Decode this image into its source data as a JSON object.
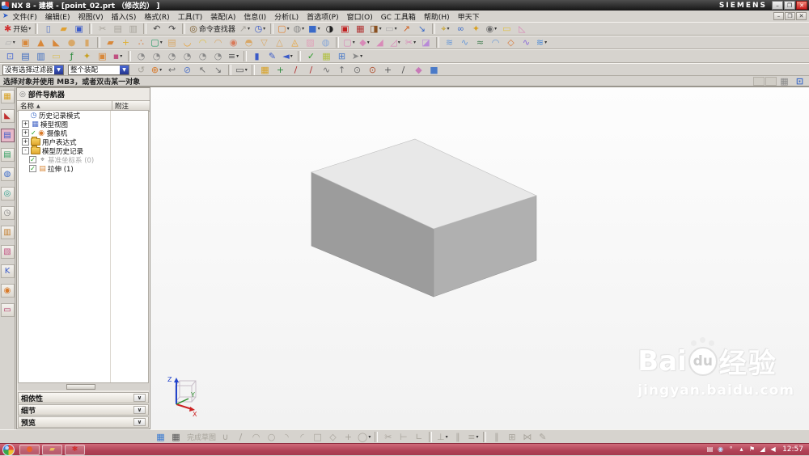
{
  "window": {
    "title": "NX 8 - 建模 - [point_02.prt （修改的） ]",
    "brand": "SIEMENS",
    "min_glyph": "–",
    "restore_glyph": "❐",
    "close_glyph": "✕"
  },
  "menubar": {
    "items": [
      "文件(F)",
      "编辑(E)",
      "视图(V)",
      "插入(S)",
      "格式(R)",
      "工具(T)",
      "装配(A)",
      "信息(I)",
      "分析(L)",
      "首选项(P)",
      "窗口(O)",
      "GC 工具箱",
      "帮助(H)",
      "甲天下"
    ]
  },
  "toolbars": {
    "row1": [
      {
        "name": "start-button",
        "g": "✱",
        "c": "#d03030",
        "label": "开始",
        "dd": true
      },
      {
        "sep": true
      },
      {
        "name": "new-button",
        "g": "▯",
        "c": "#5a7ac8"
      },
      {
        "name": "open-button",
        "g": "▰",
        "c": "#e0a030"
      },
      {
        "name": "save-button",
        "g": "▣",
        "c": "#3a5ac8"
      },
      {
        "sep": true
      },
      {
        "name": "cut-button",
        "g": "✂",
        "c": "#9a968e",
        "gray": true
      },
      {
        "name": "copy-button",
        "g": "▤",
        "c": "#9a968e",
        "gray": true
      },
      {
        "name": "paste-button",
        "g": "▥",
        "c": "#9a968e",
        "gray": true
      },
      {
        "sep": true
      },
      {
        "name": "undo-button",
        "g": "↶",
        "c": "#444444"
      },
      {
        "name": "redo-button",
        "g": "↷",
        "c": "#444444"
      },
      {
        "sep": true
      },
      {
        "name": "command-finder-button",
        "g": "◎",
        "c": "#7a5a2a",
        "label": "命令查找器"
      },
      {
        "name": "touch-mode-button",
        "g": "↗",
        "c": "#9a968e",
        "gray": true,
        "dd": true
      },
      {
        "name": "history-palette-button",
        "g": "◷",
        "c": "#3a5ac8",
        "dd": true
      },
      {
        "sep": true
      },
      {
        "name": "screenshot-button",
        "g": "▢",
        "c": "#e08030",
        "dd": true
      },
      {
        "name": "rotate-view-button",
        "g": "◍",
        "c": "#8a8a8a",
        "dd": true
      },
      {
        "name": "view-cube-button",
        "g": "■",
        "c": "#3a6ac8",
        "dd": true
      },
      {
        "name": "clock-display-button",
        "g": "◑",
        "c": "#222222"
      },
      {
        "name": "material-box-button",
        "g": "▣",
        "c": "#c02020"
      },
      {
        "name": "assembly-box-button",
        "g": "▦",
        "c": "#b03030"
      },
      {
        "name": "module-box-button",
        "g": "◨",
        "c": "#8a5020",
        "dd": true
      },
      {
        "name": "blank-window-button",
        "g": "▭",
        "c": "#aaaaaa",
        "dd": true
      },
      {
        "name": "move-object-button",
        "g": "↗",
        "c": "#d06020"
      },
      {
        "name": "copy-object-button",
        "g": "↘",
        "c": "#3a6ac8"
      },
      {
        "sep": true
      },
      {
        "name": "wcs-button",
        "g": "⌖",
        "c": "#c8a020",
        "dd": true
      },
      {
        "name": "link-button",
        "g": "∞",
        "c": "#3a6ac8"
      },
      {
        "name": "key-button",
        "g": "✦",
        "c": "#d8a020"
      },
      {
        "name": "show-hide-button",
        "g": "◉",
        "c": "#707070",
        "dd": true
      },
      {
        "name": "measure-button",
        "g": "▭",
        "c": "#e0c040"
      },
      {
        "name": "angle-measure-button",
        "g": "◺",
        "c": "#d88ab8"
      }
    ],
    "row2": [
      {
        "name": "datum-plane-button",
        "g": "▱",
        "c": "#b0b0b0",
        "dd": true
      },
      {
        "name": "block-button",
        "g": "▣",
        "c": "#d8883a"
      },
      {
        "name": "cone-button",
        "g": "▲",
        "c": "#d8883a"
      },
      {
        "name": "wedge-button",
        "g": "◣",
        "c": "#d8883a"
      },
      {
        "name": "sphere-button",
        "g": "●",
        "c": "#d8a868"
      },
      {
        "name": "cylinder-button",
        "g": "▮",
        "c": "#d8a868"
      },
      {
        "sep": true
      },
      {
        "name": "sheet-button",
        "g": "▰",
        "c": "#d8883a"
      },
      {
        "name": "datum-axis-button",
        "g": "+",
        "c": "#e0b030"
      },
      {
        "name": "point-set-button",
        "g": "∴",
        "c": "#d87a3a"
      },
      {
        "name": "sketch-button",
        "g": "▢",
        "c": "#2a9a6a",
        "dd": true
      },
      {
        "name": "extrude-button",
        "g": "▤",
        "c": "#d8a868"
      },
      {
        "name": "revolve-button",
        "g": "◡",
        "c": "#e8a030"
      },
      {
        "name": "sweep-button",
        "g": "◠",
        "c": "#e0c040"
      },
      {
        "name": "tube-button",
        "g": "◠",
        "c": "#d8a868"
      },
      {
        "name": "hole-button",
        "g": "◉",
        "c": "#d87a5a"
      },
      {
        "name": "boss-button",
        "g": "◓",
        "c": "#d8a868"
      },
      {
        "name": "pocket-button",
        "g": "▽",
        "c": "#d8a868"
      },
      {
        "name": "pad-button",
        "g": "△",
        "c": "#d8a868"
      },
      {
        "name": "emboss-button",
        "g": "◬",
        "c": "#e8a030"
      },
      {
        "name": "sheet-body-button",
        "g": "▨",
        "c": "#e0a0b8"
      },
      {
        "name": "sphere-surface-button",
        "g": "◍",
        "c": "#88a8d8"
      },
      {
        "sep": true
      },
      {
        "name": "shell-button",
        "g": "▢",
        "c": "#d88ab8",
        "dd": true
      },
      {
        "name": "edge-blend-button",
        "g": "◆",
        "c": "#d88ab8",
        "dd": true
      },
      {
        "name": "chamfer-button",
        "g": "◢",
        "c": "#d88ab8"
      },
      {
        "name": "draft-button",
        "g": "◿",
        "c": "#d88ab8",
        "dd": true
      },
      {
        "name": "trim-body-button",
        "g": "✂",
        "c": "#d88ab8",
        "dd": true
      },
      {
        "name": "patch-button",
        "g": "◪",
        "c": "#b88ad8"
      },
      {
        "sep": true
      },
      {
        "name": "four-point-surface-button",
        "g": "≋",
        "c": "#6a9ad8"
      },
      {
        "name": "swept-button",
        "g": "∿",
        "c": "#6a9ad8"
      },
      {
        "name": "through-curves-button",
        "g": "≈",
        "c": "#3a7a4a"
      },
      {
        "name": "styled-sweep-button",
        "g": "◠",
        "c": "#6a9ad8"
      },
      {
        "name": "n-sided-surface-button",
        "g": "◇",
        "c": "#d87a3a"
      },
      {
        "name": "studio-surface-button",
        "g": "∿",
        "c": "#8a6ad8"
      },
      {
        "name": "more-surface-button",
        "g": "≋",
        "c": "#4a8ad8",
        "dd": true
      }
    ],
    "row3": [
      {
        "name": "fit-view-button",
        "g": "⊡",
        "c": "#4a6ad0"
      },
      {
        "name": "layer-settings-button",
        "g": "▤",
        "c": "#3a6ac0"
      },
      {
        "name": "layer-visible-button",
        "g": "▥",
        "c": "#3a6ac0"
      },
      {
        "name": "annotation-button",
        "g": "▭",
        "c": "#d8c060"
      },
      {
        "name": "expression-button",
        "g": "ƒ",
        "c": "#2a8a3a"
      },
      {
        "name": "tools-button",
        "g": "✦",
        "c": "#c8a020"
      },
      {
        "name": "part-module-button",
        "g": "▣",
        "c": "#d8883a"
      },
      {
        "name": "customize-button",
        "g": "▪",
        "c": "#c05080",
        "dd": true
      },
      {
        "sep": true
      },
      {
        "name": "render-style-1-button",
        "g": "◔",
        "c": "#888888"
      },
      {
        "name": "render-style-2-button",
        "g": "◔",
        "c": "#888888"
      },
      {
        "name": "render-style-3-button",
        "g": "◔",
        "c": "#888888"
      },
      {
        "name": "render-style-4-button",
        "g": "◔",
        "c": "#888888"
      },
      {
        "name": "render-style-5-button",
        "g": "◔",
        "c": "#888888"
      },
      {
        "name": "render-style-6-button",
        "g": "◔",
        "c": "#888888"
      },
      {
        "name": "render-list-button",
        "g": "≡",
        "c": "#555555",
        "dd": true
      },
      {
        "sep": true
      },
      {
        "name": "material-edit-button",
        "g": "▮",
        "c": "#3a5ac8"
      },
      {
        "name": "pen-button",
        "g": "✎",
        "c": "#3a5ac8"
      },
      {
        "name": "erase-button",
        "g": "◄",
        "c": "#3a5ac8",
        "dd": true
      },
      {
        "sep": true
      },
      {
        "name": "check-mate-button",
        "g": "✓",
        "c": "#2a9a2a"
      },
      {
        "name": "sheet-check-button",
        "g": "▦",
        "c": "#b0c040"
      },
      {
        "name": "grid-button",
        "g": "⊞",
        "c": "#4a7ac8"
      },
      {
        "name": "select-tool-button",
        "g": "➤",
        "c": "#888888",
        "dd": true
      }
    ],
    "selection": [
      {
        "name": "refresh-button",
        "g": "↺",
        "c": "#9a968e",
        "gray": true
      },
      {
        "name": "add-to-selection-button",
        "g": "⊕",
        "c": "#d87a2a",
        "dd": true
      },
      {
        "name": "previous-selection-button",
        "g": "↩",
        "c": "#707070"
      },
      {
        "name": "deselect-all-button",
        "g": "⊘",
        "c": "#5a7ac8"
      },
      {
        "name": "select-handle-button",
        "g": "↖",
        "c": "#707070"
      },
      {
        "name": "select-handle2-button",
        "g": "↘",
        "c": "#707070"
      },
      {
        "sep": true
      },
      {
        "name": "rectangle-select-button",
        "g": "▭",
        "c": "#555555",
        "dd": true
      },
      {
        "sep": true
      },
      {
        "name": "snap-point-toggle-button",
        "g": "▦",
        "c": "#d8a020"
      },
      {
        "name": "snap-point-settings-button",
        "g": "+",
        "c": "#2a8a3a"
      },
      {
        "name": "end-point-button",
        "g": "/",
        "c": "#b03030"
      },
      {
        "name": "mid-point-button",
        "g": "/",
        "c": "#b03030"
      },
      {
        "name": "control-point-button",
        "g": "∿",
        "c": "#707070"
      },
      {
        "name": "intersection-button",
        "g": "↑",
        "c": "#707070"
      },
      {
        "name": "arc-center-button",
        "g": "⊙",
        "c": "#707070"
      },
      {
        "name": "quadrant-point-button",
        "g": "⊙",
        "c": "#b05030"
      },
      {
        "name": "existing-point-button",
        "g": "+",
        "c": "#555555"
      },
      {
        "name": "point-on-curve-button",
        "g": "/",
        "c": "#555555"
      },
      {
        "name": "point-on-surface-button",
        "g": "◆",
        "c": "#c87ab8"
      },
      {
        "name": "bounded-plane-button",
        "g": "■",
        "c": "#4a7ac8"
      }
    ],
    "sketch": [
      {
        "name": "sketch-env-button",
        "g": "▦",
        "c": "#3a7ad0"
      },
      {
        "name": "sketch-grid-button",
        "g": "▦",
        "c": "#555555"
      },
      {
        "name": "finish-sketch-button",
        "label": "完成草图",
        "gray": true
      },
      {
        "name": "profile-button",
        "g": "∪",
        "c": "#777777",
        "gray": true
      },
      {
        "name": "line-button",
        "g": "/",
        "c": "#777777",
        "gray": true
      },
      {
        "name": "arc-button",
        "g": "◠",
        "c": "#777777",
        "gray": true
      },
      {
        "name": "circle-button",
        "g": "○",
        "c": "#777777",
        "gray": true
      },
      {
        "name": "arc-3pt-button",
        "g": "◝",
        "c": "#777777",
        "gray": true
      },
      {
        "name": "fillet-button",
        "g": "◜",
        "c": "#777777",
        "gray": true
      },
      {
        "name": "rectangle-button",
        "g": "□",
        "c": "#777777",
        "gray": true
      },
      {
        "name": "polygon-button",
        "g": "◇",
        "c": "#777777",
        "gray": true
      },
      {
        "name": "point-button",
        "g": "+",
        "c": "#777777",
        "gray": true
      },
      {
        "name": "ellipse-button",
        "g": "◯",
        "c": "#777777",
        "gray": true,
        "dd": true
      },
      {
        "sep": true
      },
      {
        "name": "quick-trim-button",
        "g": "✂",
        "c": "#777777",
        "gray": true
      },
      {
        "name": "quick-extend-button",
        "g": "⊢",
        "c": "#777777",
        "gray": true
      },
      {
        "name": "make-corner-button",
        "g": "∟",
        "c": "#777777",
        "gray": true
      },
      {
        "sep": true
      },
      {
        "name": "constraints-button",
        "g": "⊥",
        "c": "#777777",
        "gray": true,
        "dd": true
      },
      {
        "name": "auto-constrain-button",
        "g": "∥",
        "c": "#777777",
        "gray": true
      },
      {
        "name": "show-constraints-button",
        "g": "≡",
        "c": "#777777",
        "gray": true,
        "dd": true
      },
      {
        "sep": true
      },
      {
        "name": "offset-curve-button",
        "g": "∥",
        "c": "#777777",
        "gray": true
      },
      {
        "name": "pattern-curve-button",
        "g": "⊞",
        "c": "#777777",
        "gray": true
      },
      {
        "name": "mirror-curve-button",
        "g": "⋈",
        "c": "#777777",
        "gray": true
      },
      {
        "name": "edit-curve-button",
        "g": "✎",
        "c": "#777777",
        "gray": true
      }
    ],
    "resource": [
      {
        "name": "assembly-navigator-tab",
        "g": "▦",
        "c": "#d8a020"
      },
      {
        "name": "constraint-navigator-tab",
        "g": "◣",
        "c": "#c03030"
      },
      {
        "name": "part-navigator-tab",
        "g": "▤",
        "c": "#3a5ac8",
        "active": true
      },
      {
        "name": "reuse-library-tab",
        "g": "▤",
        "c": "#2a9a5a"
      },
      {
        "name": "web-browser-tab",
        "g": "◍",
        "c": "#3a6ac8"
      },
      {
        "name": "history-tab",
        "g": "◎",
        "c": "#2a9a8a"
      },
      {
        "name": "system-materials-tab",
        "g": "◷",
        "c": "#7a7a7a"
      },
      {
        "name": "process-studio-tab",
        "g": "▥",
        "c": "#c07a2a"
      },
      {
        "name": "roles-tab",
        "g": "▧",
        "c": "#c05080"
      },
      {
        "name": "knowledge-fusion-tab",
        "g": "K",
        "c": "#3a5ac8"
      },
      {
        "name": "groups-tab",
        "g": "◉",
        "c": "#d87a2a"
      },
      {
        "name": "gallery-tab",
        "g": "▭",
        "c": "#b03060"
      }
    ],
    "prompt_buttons": [
      {
        "name": "snapshot-button",
        "g": "▦",
        "c": "#8a8a8a"
      },
      {
        "name": "cursor-tracking-button",
        "g": "⊡",
        "c": "#3a6ac8"
      }
    ],
    "tray": [
      {
        "name": "language-indicator",
        "g": "▤",
        "c": "#ffffff"
      },
      {
        "name": "safety-icon",
        "g": "◉",
        "c": "#bfe0ff"
      },
      {
        "name": "dots-icon",
        "g": "°",
        "c": "#ffffff"
      },
      {
        "name": "show-hidden-icons-button",
        "g": "▴",
        "c": "#ffffff"
      },
      {
        "name": "action-center-icon",
        "g": "⚑",
        "c": "#ffffff"
      },
      {
        "name": "network-icon",
        "g": "◢",
        "c": "#ffffff"
      },
      {
        "name": "volume-icon",
        "g": "◀",
        "c": "#ffffff"
      }
    ],
    "taskbar_apps": [
      {
        "name": "taskbar-browser-button",
        "g": "●",
        "c": "#e86030"
      },
      {
        "name": "taskbar-explorer-button",
        "g": "▰",
        "c": "#e8c060"
      },
      {
        "name": "taskbar-nx-button",
        "g": "✱",
        "c": "#d03030"
      }
    ]
  },
  "selection_bar": {
    "filter": "没有选择过滤器",
    "scope": "整个装配"
  },
  "prompt": {
    "text": "选择对象并使用 MB3，或者双击某一对象"
  },
  "navigator": {
    "title": "部件导航器",
    "col_name": "名称",
    "col_sort": "▲",
    "col_comment": "附注",
    "items": [
      {
        "name": "tree-item-history-mode",
        "indent": 1,
        "exp": "",
        "itype": "glyph",
        "g": "◷",
        "c": "#3a6ac8",
        "label": "历史记录模式"
      },
      {
        "name": "tree-item-model-views",
        "indent": 0,
        "exp": "+",
        "itype": "glyph",
        "g": "▦",
        "c": "#4a6ac8",
        "label": "模型视图"
      },
      {
        "name": "tree-item-cameras",
        "indent": 0,
        "exp": "+",
        "pre": "✓",
        "itype": "glyph",
        "g": "◉",
        "c": "#d87a2a",
        "label": "摄像机"
      },
      {
        "name": "tree-item-user-expressions",
        "indent": 0,
        "exp": "+",
        "itype": "folder",
        "label": "用户表达式"
      },
      {
        "name": "tree-item-model-history",
        "indent": 0,
        "exp": "-",
        "itype": "folder",
        "label": "模型历史记录"
      },
      {
        "name": "tree-item-datum-csys",
        "indent": 1,
        "check": true,
        "itype": "glyph",
        "g": "⌖",
        "c": "#7a7a7a",
        "label": "基准坐标系 (0)",
        "gray": true
      },
      {
        "name": "tree-item-extrude",
        "indent": 1,
        "check": true,
        "itype": "glyph",
        "g": "▤",
        "c": "#d8883a",
        "label": "拉伸 (1)"
      }
    ],
    "panels": [
      "相依性",
      "细节",
      "预览"
    ],
    "chevron": "∨"
  },
  "viewport": {
    "triad_x": "X",
    "triad_y": "Y",
    "triad_z": "Z"
  },
  "watermark": {
    "brand_left": "Bai",
    "paw_text": "du",
    "brand_right": "经验",
    "url": "jingyan.baidu.com"
  },
  "taskbar": {
    "clock": "12:57"
  },
  "colors": {
    "chrome": "#d6d3ce",
    "titlebar": "#1c1c1c",
    "taskbar": "#b04256",
    "box_top": "#e8e8e8",
    "box_left": "#9c9c9c",
    "box_right": "#b0b0b0"
  }
}
